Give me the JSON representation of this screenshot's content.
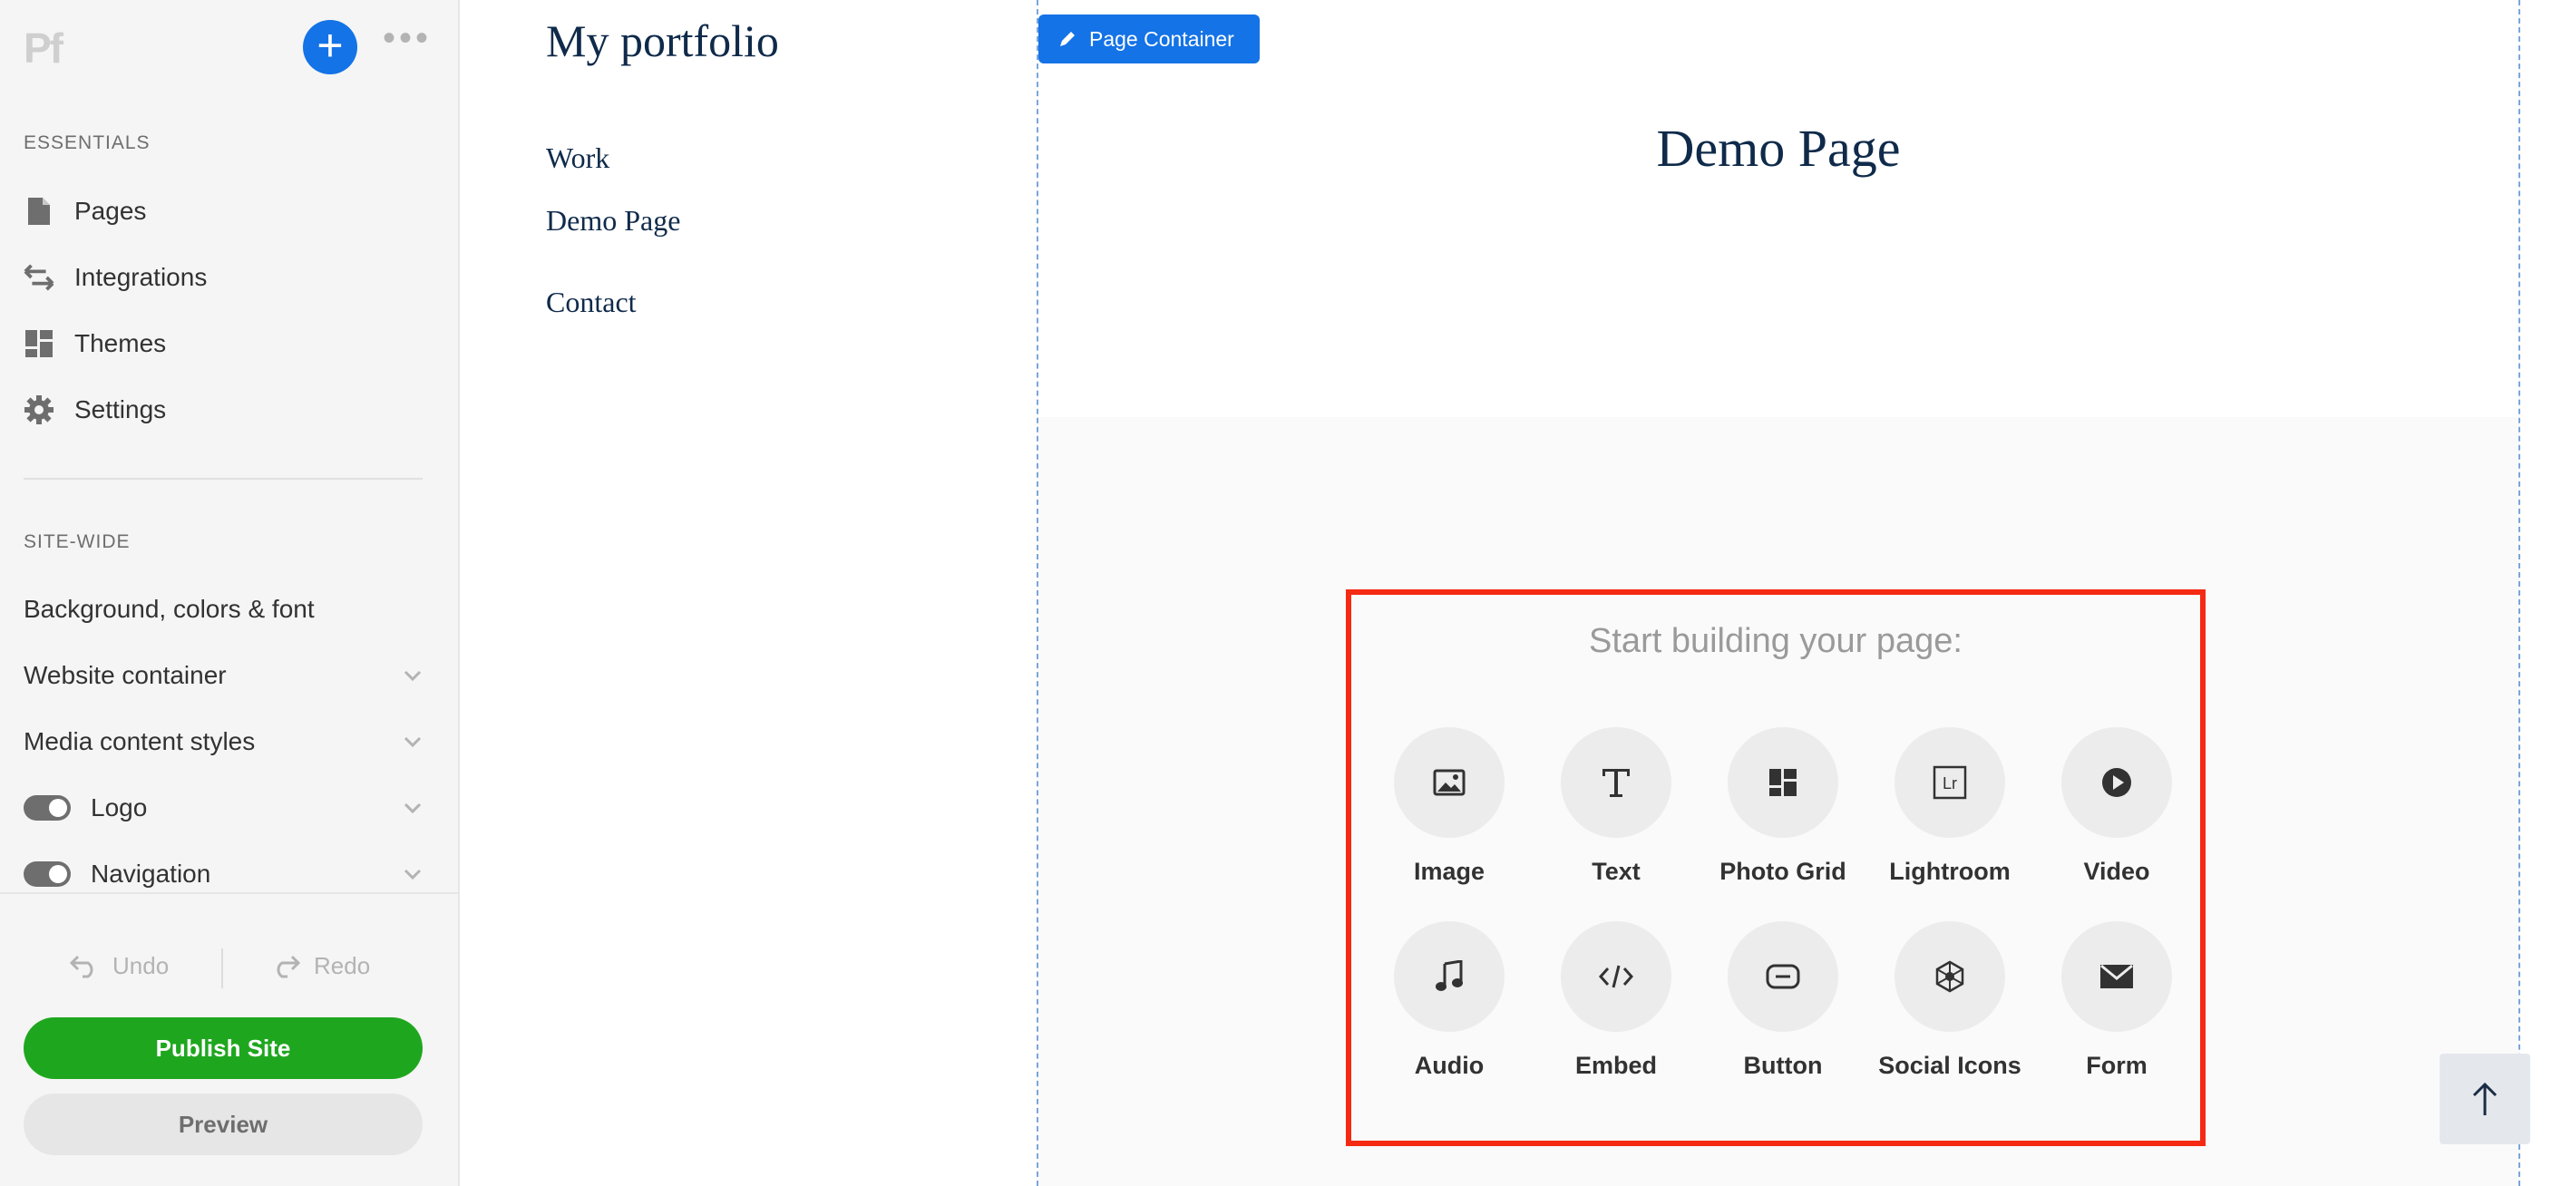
{
  "sidebar": {
    "logo_text": "Pf",
    "add_label": "+",
    "more_label": "•••",
    "essentials_header": "ESSENTIALS",
    "essentials": [
      {
        "label": "Pages",
        "icon": "page-icon"
      },
      {
        "label": "Integrations",
        "icon": "arrows-icon"
      },
      {
        "label": "Themes",
        "icon": "grid-icon"
      },
      {
        "label": "Settings",
        "icon": "gear-icon"
      }
    ],
    "sitewide_header": "SITE-WIDE",
    "sitewide": [
      {
        "label": "Background, colors & font"
      },
      {
        "label": "Website container"
      },
      {
        "label": "Media content styles"
      },
      {
        "label": "Logo"
      },
      {
        "label": "Navigation"
      }
    ],
    "undo_label": "Undo",
    "redo_label": "Redo",
    "publish_label": "Publish Site",
    "preview_label": "Preview"
  },
  "site": {
    "title": "My portfolio",
    "nav": [
      "Work",
      "Demo Page",
      "Contact"
    ]
  },
  "editor": {
    "container_badge": "Page Container",
    "page_title": "Demo Page",
    "builder_title": "Start building your page:",
    "tiles": [
      {
        "label": "Image",
        "icon": "image-icon"
      },
      {
        "label": "Text",
        "icon": "text-icon"
      },
      {
        "label": "Photo Grid",
        "icon": "photo-grid-icon"
      },
      {
        "label": "Lightroom",
        "icon": "lightroom-icon"
      },
      {
        "label": "Video",
        "icon": "video-icon"
      },
      {
        "label": "Audio",
        "icon": "audio-icon"
      },
      {
        "label": "Embed",
        "icon": "embed-icon"
      },
      {
        "label": "Button",
        "icon": "button-icon"
      },
      {
        "label": "Social Icons",
        "icon": "social-icons-icon"
      },
      {
        "label": "Form",
        "icon": "form-icon"
      }
    ]
  },
  "colors": {
    "accent": "#1473e6",
    "publish": "#1ea71e",
    "highlight": "#f52a12",
    "site_text": "#0f2a4a"
  }
}
